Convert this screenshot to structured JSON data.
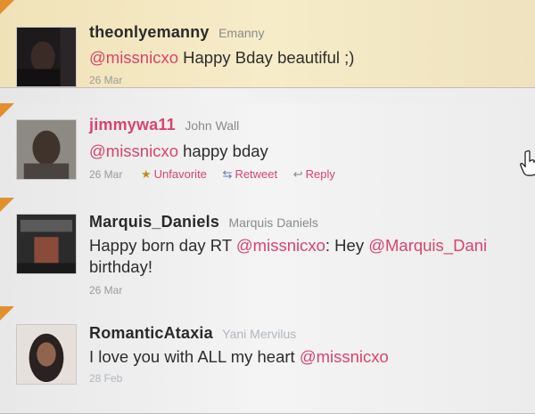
{
  "tweets": [
    {
      "screen_name": "theonlyemanny",
      "full_name": "Emanny",
      "mention": "@missnicxo",
      "text_after": " Happy Bday beautiful ;)",
      "date": "26 Mar"
    },
    {
      "screen_name": "jimmywa11",
      "full_name": "John Wall",
      "mention": "@missnicxo",
      "text_after": " happy bday",
      "date": "26 Mar",
      "actions": {
        "unfavorite": "Unfavorite",
        "retweet": "Retweet",
        "reply": "Reply"
      }
    },
    {
      "screen_name": "Marquis_Daniels",
      "full_name": "Marquis Daniels",
      "text_before": "Happy born day RT ",
      "mention": "@missnicxo",
      "text_middle": ": Hey ",
      "mention2": "@Marquis_Dani",
      "line2": "birthday!",
      "date": "26 Mar"
    },
    {
      "screen_name": "RomanticAtaxia",
      "full_name": "Yani Mervilus",
      "text_before": "I love you with ALL my heart ",
      "mention": "@missnicxo",
      "date": "28 Feb"
    }
  ],
  "colors": {
    "link": "#d9436f",
    "favorite_bg": "#f6ecc8",
    "corner": "#e0902f"
  },
  "icons": [
    "star-icon",
    "retweet-icon",
    "reply-icon",
    "hand-cursor-icon"
  ]
}
